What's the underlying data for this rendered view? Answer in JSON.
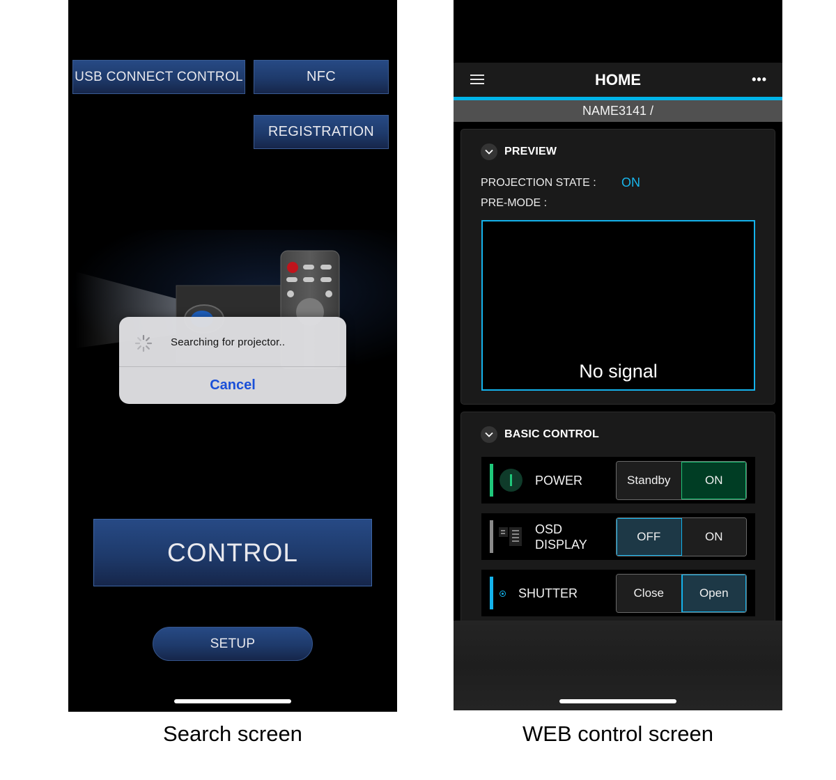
{
  "search_screen": {
    "buttons": {
      "usb_connect_control": "USB CONNECT CONTROL",
      "nfc": "NFC",
      "registration": "REGISTRATION",
      "control": "CONTROL",
      "setup": "SETUP"
    },
    "illustration": "projector-and-remote",
    "alert": {
      "icon": "activity-spinner-icon",
      "message": "Searching for projector..",
      "cancel_label": "Cancel"
    },
    "caption": "Search screen"
  },
  "web_control_screen": {
    "header": {
      "menu_icon": "hamburger-menu-icon",
      "title": "HOME",
      "more_icon": "more-ellipsis-icon",
      "more_label": "•••"
    },
    "breadcrumb": "NAME3141 /",
    "accent_color": "#00b4e8",
    "preview": {
      "title": "PREVIEW",
      "projection_state_label": "PROJECTION STATE :",
      "projection_state_value": "ON",
      "pre_mode_label": "PRE-MODE :",
      "pre_mode_value": "",
      "preview_message": "No signal"
    },
    "basic_control": {
      "title": "BASIC CONTROL",
      "rows": [
        {
          "label": "POWER",
          "icon": "power-icon",
          "indicator_color": "#1fc77a",
          "options": [
            "Standby",
            "ON"
          ],
          "selected": "ON"
        },
        {
          "label_line1": "OSD",
          "label_line2": "DISPLAY",
          "icon": "osd-display-icon",
          "indicator_color": "#8a8a8a",
          "options": [
            "OFF",
            "ON"
          ],
          "selected": "OFF"
        },
        {
          "label": "SHUTTER",
          "icon": "shutter-radio-icon",
          "indicator_color": "#14b3ec",
          "options": [
            "Close",
            "Open"
          ],
          "selected": "Open"
        }
      ]
    },
    "caption": "WEB control screen"
  }
}
